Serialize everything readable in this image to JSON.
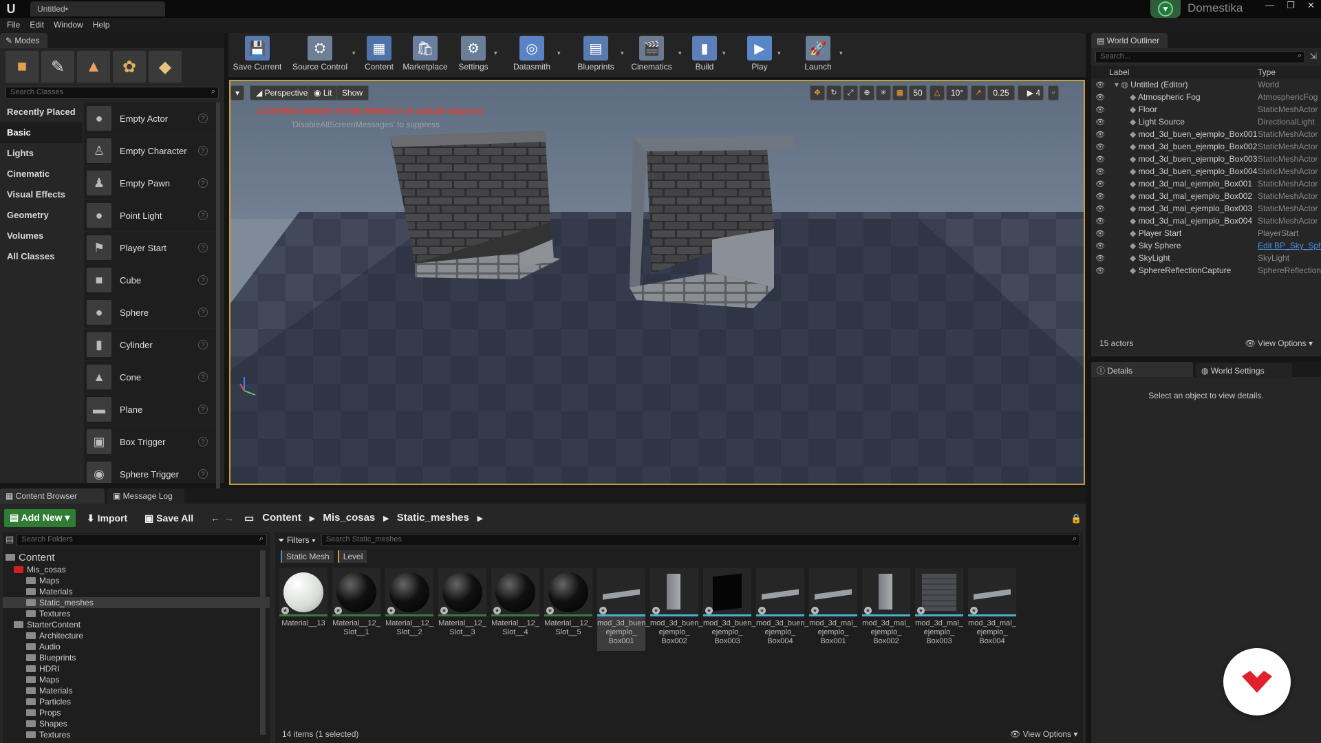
{
  "window": {
    "doc_tab": "Untitled•",
    "brand": "Domestika",
    "controls": [
      "—",
      "❐",
      "✕"
    ]
  },
  "menu": [
    "File",
    "Edit",
    "Window",
    "Help"
  ],
  "modes": {
    "tab": "Modes",
    "search_placeholder": "Search Classes",
    "categories": [
      "Recently Placed",
      "Basic",
      "Lights",
      "Cinematic",
      "Visual Effects",
      "Geometry",
      "Volumes",
      "All Classes"
    ],
    "items": [
      "Empty Actor",
      "Empty Character",
      "Empty Pawn",
      "Point Light",
      "Player Start",
      "Cube",
      "Sphere",
      "Cylinder",
      "Cone",
      "Plane",
      "Box Trigger",
      "Sphere Trigger"
    ]
  },
  "toolbar": [
    {
      "label": "Save Current",
      "icon": "save-icon",
      "color": "#5c78b0"
    },
    {
      "label": "Source Control",
      "icon": "source-control-icon",
      "color": "#6f7f95"
    },
    {
      "label": "Content",
      "icon": "content-icon",
      "color": "#4d73a8"
    },
    {
      "label": "Marketplace",
      "icon": "marketplace-icon",
      "color": "#6a7ea0"
    },
    {
      "label": "Settings",
      "icon": "settings-icon",
      "color": "#6a7e98"
    },
    {
      "label": "Datasmith",
      "icon": "datasmith-icon",
      "color": "#5a82c4"
    },
    {
      "label": "Blueprints",
      "icon": "blueprints-icon",
      "color": "#5a7bb0"
    },
    {
      "label": "Cinematics",
      "icon": "cinematics-icon",
      "color": "#6a7a90"
    },
    {
      "label": "Build",
      "icon": "build-icon",
      "color": "#5d7fb8"
    },
    {
      "label": "Play",
      "icon": "play-icon",
      "color": "#5a86c8"
    },
    {
      "label": "Launch",
      "icon": "launch-icon",
      "color": "#6a7e98"
    }
  ],
  "viewport": {
    "perspective": "Perspective",
    "lit": "Lit",
    "show": "Show",
    "warning": "LIGHTING NEEDS TO BE REBUILT (8 unbuilt objects)",
    "suppress": "'DisableAllScreenMessages' to suppress",
    "grid": "50",
    "rotation": "10°",
    "scale": "0.25",
    "camera_speed": "4",
    "colors": {
      "warning": "#e04030",
      "border": "#c8a030"
    }
  },
  "outliner": {
    "tab": "World Outliner",
    "search_placeholder": "Search...",
    "col_label": "Label",
    "col_type": "Type",
    "rows": [
      {
        "label": "Untitled (Editor)",
        "type": "World"
      },
      {
        "label": "Atmospheric Fog",
        "type": "AtmosphericFog"
      },
      {
        "label": "Floor",
        "type": "StaticMeshActor"
      },
      {
        "label": "Light Source",
        "type": "DirectionalLight"
      },
      {
        "label": "mod_3d_buen_ejemplo_Box001",
        "type": "StaticMeshActor"
      },
      {
        "label": "mod_3d_buen_ejemplo_Box002",
        "type": "StaticMeshActor"
      },
      {
        "label": "mod_3d_buen_ejemplo_Box003",
        "type": "StaticMeshActor"
      },
      {
        "label": "mod_3d_buen_ejemplo_Box004",
        "type": "StaticMeshActor"
      },
      {
        "label": "mod_3d_mal_ejemplo_Box001",
        "type": "StaticMeshActor"
      },
      {
        "label": "mod_3d_mal_ejemplo_Box002",
        "type": "StaticMeshActor"
      },
      {
        "label": "mod_3d_mal_ejemplo_Box003",
        "type": "StaticMeshActor"
      },
      {
        "label": "mod_3d_mal_ejemplo_Box004",
        "type": "StaticMeshActor"
      },
      {
        "label": "Player Start",
        "type": "PlayerStart"
      },
      {
        "label": "Sky Sphere",
        "type": "Edit BP_Sky_Sphere"
      },
      {
        "label": "SkyLight",
        "type": "SkyLight"
      },
      {
        "label": "SphereReflectionCapture",
        "type": "SphereReflectionCapture"
      }
    ],
    "count": "15 actors",
    "view_options": "View Options"
  },
  "details": {
    "tab_details": "Details",
    "tab_world": "World Settings",
    "empty": "Select an object to view details."
  },
  "content_browser": {
    "tab": "Content Browser",
    "tab_log": "Message Log",
    "add_new": "Add New",
    "import": "Import",
    "save_all": "Save All",
    "path": [
      "Content",
      "Mis_cosas",
      "Static_meshes"
    ],
    "search_folders": "Search Folders",
    "filters": "Filters",
    "search_assets": "Search Static_meshes",
    "chips": [
      "Static Mesh",
      "Level"
    ],
    "folders": [
      {
        "name": "Content",
        "depth": 0
      },
      {
        "name": "Mis_cosas",
        "depth": 1
      },
      {
        "name": "Maps",
        "depth": 2
      },
      {
        "name": "Materials",
        "depth": 2
      },
      {
        "name": "Static_meshes",
        "depth": 2
      },
      {
        "name": "Textures",
        "depth": 2
      },
      {
        "name": "StarterContent",
        "depth": 1
      },
      {
        "name": "Architecture",
        "depth": 2
      },
      {
        "name": "Audio",
        "depth": 2
      },
      {
        "name": "Blueprints",
        "depth": 2
      },
      {
        "name": "HDRI",
        "depth": 2
      },
      {
        "name": "Maps",
        "depth": 2
      },
      {
        "name": "Materials",
        "depth": 2
      },
      {
        "name": "Particles",
        "depth": 2
      },
      {
        "name": "Props",
        "depth": 2
      },
      {
        "name": "Shapes",
        "depth": 2
      },
      {
        "name": "Textures",
        "depth": 2
      }
    ],
    "assets": [
      {
        "name": "Material__13",
        "kind": "white"
      },
      {
        "name": "Material__12_ Slot__1",
        "kind": "black"
      },
      {
        "name": "Material__12_ Slot__2",
        "kind": "black"
      },
      {
        "name": "Material__12_ Slot__3",
        "kind": "black"
      },
      {
        "name": "Material__12_ Slot__4",
        "kind": "black"
      },
      {
        "name": "Material__12_ Slot__5",
        "kind": "black"
      },
      {
        "name": "mod_3d_buen_ ejemplo_ Box001",
        "kind": "slab"
      },
      {
        "name": "mod_3d_buen_ ejemplo_ Box002",
        "kind": "wall"
      },
      {
        "name": "mod_3d_buen_ ejemplo_ Box003",
        "kind": "dark"
      },
      {
        "name": "mod_3d_buen_ ejemplo_ Box004",
        "kind": "slab"
      },
      {
        "name": "mod_3d_mal_ ejemplo_ Box001",
        "kind": "slab"
      },
      {
        "name": "mod_3d_mal_ ejemplo_ Box002",
        "kind": "wall"
      },
      {
        "name": "mod_3d_mal_ ejemplo_ Box003",
        "kind": "stone"
      },
      {
        "name": "mod_3d_mal_ ejemplo_ Box004",
        "kind": "slab"
      }
    ],
    "status": "14 items (1 selected)",
    "view_options": "View Options"
  }
}
